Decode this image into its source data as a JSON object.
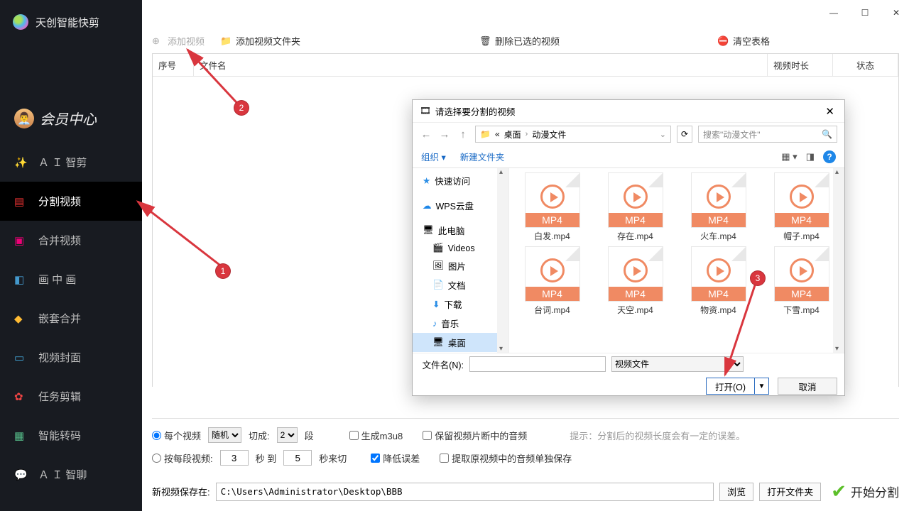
{
  "app": {
    "title": "天创智能快剪"
  },
  "vip": {
    "label": "会员中心"
  },
  "nav": [
    {
      "label": "Ａ Ｉ 智剪",
      "icon": "wand"
    },
    {
      "label": "分割视频",
      "icon": "split",
      "active": true
    },
    {
      "label": "合并视频",
      "icon": "merge"
    },
    {
      "label": "画 中 画",
      "icon": "pip"
    },
    {
      "label": "嵌套合并",
      "icon": "nest"
    },
    {
      "label": "视频封面",
      "icon": "cover"
    },
    {
      "label": "任务剪辑",
      "icon": "task"
    },
    {
      "label": "智能转码",
      "icon": "transcode"
    },
    {
      "label": "Ａ Ｉ 智聊",
      "icon": "chat"
    }
  ],
  "toolbar": {
    "add_video": "添加视频",
    "add_folder": "添加视频文件夹",
    "delete_selected": "删除已选的视频",
    "clear_table": "清空表格"
  },
  "table": {
    "col_index": "序号",
    "col_name": "文件名",
    "col_duration": "视频时长",
    "col_status": "状态"
  },
  "options": {
    "each_video": "每个视频",
    "random": "随机",
    "cut_into": "切成:",
    "cut_count": "2",
    "segment": "段",
    "gen_m3u8": "生成m3u8",
    "keep_audio": "保留视频片断中的音频",
    "by_segment": "按每段视频:",
    "seg_from": "3",
    "sec_to": "秒 到",
    "seg_to": "5",
    "sec_cut": "秒来切",
    "reduce_error": "降低误差",
    "extract_audio": "提取原视频中的音频单独保存",
    "hint": "提示：分割后的视频长度会有一定的误差。"
  },
  "footer": {
    "save_label": "新视频保存在:",
    "path": "C:\\Users\\Administrator\\Desktop\\BBB",
    "browse": "浏览",
    "open_folder": "打开文件夹",
    "start": "开始分割"
  },
  "dialog": {
    "title": "请选择要分割的视频",
    "breadcrumb_1": "桌面",
    "breadcrumb_2": "动漫文件",
    "search_placeholder": "搜索\"动漫文件\"",
    "organize": "组织",
    "new_folder": "新建文件夹",
    "tree": {
      "quick": "快速访问",
      "wps": "WPS云盘",
      "pc": "此电脑",
      "videos": "Videos",
      "pictures": "图片",
      "docs": "文档",
      "downloads": "下载",
      "music": "音乐",
      "desktop": "桌面"
    },
    "files": [
      "白发.mp4",
      "存在.mp4",
      "火车.mp4",
      "帽子.mp4",
      "台词.mp4",
      "天空.mp4",
      "物资.mp4",
      "下雪.mp4"
    ],
    "mp4_label": "MP4",
    "filename_label": "文件名(N):",
    "filetype": "视频文件",
    "open": "打开(O)",
    "cancel": "取消"
  },
  "annotations": {
    "b1": "1",
    "b2": "2",
    "b3": "3"
  }
}
